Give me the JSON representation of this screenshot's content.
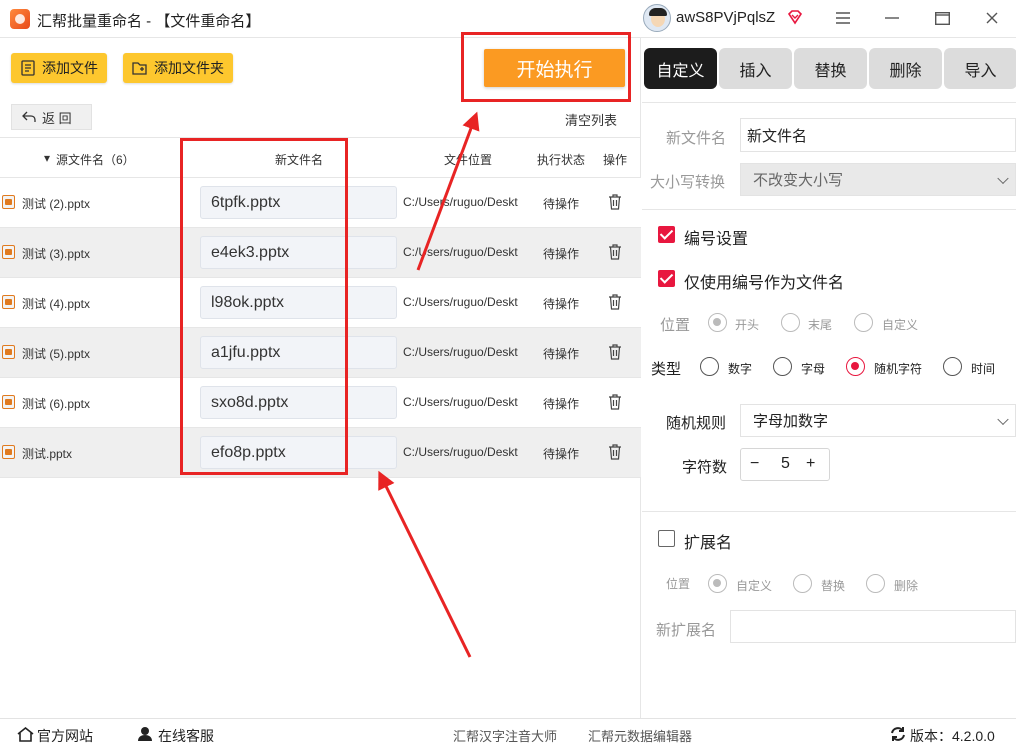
{
  "window": {
    "title": "汇帮批量重命名 - 【文件重命名】",
    "username": "awS8PVjPqlsZ"
  },
  "toolbar": {
    "add_file": "添加文件",
    "add_folder": "添加文件夹",
    "start": "开始执行",
    "back": "返 回",
    "clear_list": "清空列表"
  },
  "table": {
    "headers": {
      "source": "源文件名（6）",
      "new_name": "新文件名",
      "location": "文件位置",
      "status": "执行状态",
      "action": "操作"
    },
    "rows": [
      {
        "source": "测试 (2).pptx",
        "new_name": "6tpfk.pptx",
        "location": "C:/Users/ruguo/Deskt",
        "status": "待操作"
      },
      {
        "source": "测试 (3).pptx",
        "new_name": "e4ek3.pptx",
        "location": "C:/Users/ruguo/Deskt",
        "status": "待操作"
      },
      {
        "source": "测试 (4).pptx",
        "new_name": "l98ok.pptx",
        "location": "C:/Users/ruguo/Deskt",
        "status": "待操作"
      },
      {
        "source": "测试 (5).pptx",
        "new_name": "a1jfu.pptx",
        "location": "C:/Users/ruguo/Deskt",
        "status": "待操作"
      },
      {
        "source": "测试 (6).pptx",
        "new_name": "sxo8d.pptx",
        "location": "C:/Users/ruguo/Deskt",
        "status": "待操作"
      },
      {
        "source": "测试.pptx",
        "new_name": "efo8p.pptx",
        "location": "C:/Users/ruguo/Deskt",
        "status": "待操作"
      }
    ]
  },
  "tabs": [
    "自定义",
    "插入",
    "替换",
    "删除",
    "导入"
  ],
  "settings": {
    "new_name_label": "新文件名",
    "new_name_value": "新文件名",
    "case_label": "大小写转换",
    "case_value": "不改变大小写",
    "numbering_label": "编号设置",
    "number_only_label": "仅使用编号作为文件名",
    "position_label": "位置",
    "position_options": [
      "开头",
      "末尾",
      "自定义"
    ],
    "type_label": "类型",
    "type_options": [
      "数字",
      "字母",
      "随机字符",
      "时间"
    ],
    "random_rule_label": "随机规则",
    "random_rule_value": "字母加数字",
    "char_count_label": "字符数",
    "char_count_value": "5",
    "minus": "−",
    "plus": "+",
    "extension_label": "扩展名",
    "ext_position_label": "位置",
    "ext_position_options": [
      "自定义",
      "替换",
      "删除"
    ],
    "new_ext_label": "新扩展名"
  },
  "footer": {
    "website": "官方网站",
    "support": "在线客服",
    "tool1": "汇帮汉字注音大师",
    "tool2": "汇帮元数据编辑器",
    "version": "版本：4.2.0.0"
  },
  "colors": {
    "accent_red": "#e8173f",
    "button_yellow": "#fdc72e",
    "start_orange": "#fb9a22",
    "annotation_red": "#e82424"
  }
}
